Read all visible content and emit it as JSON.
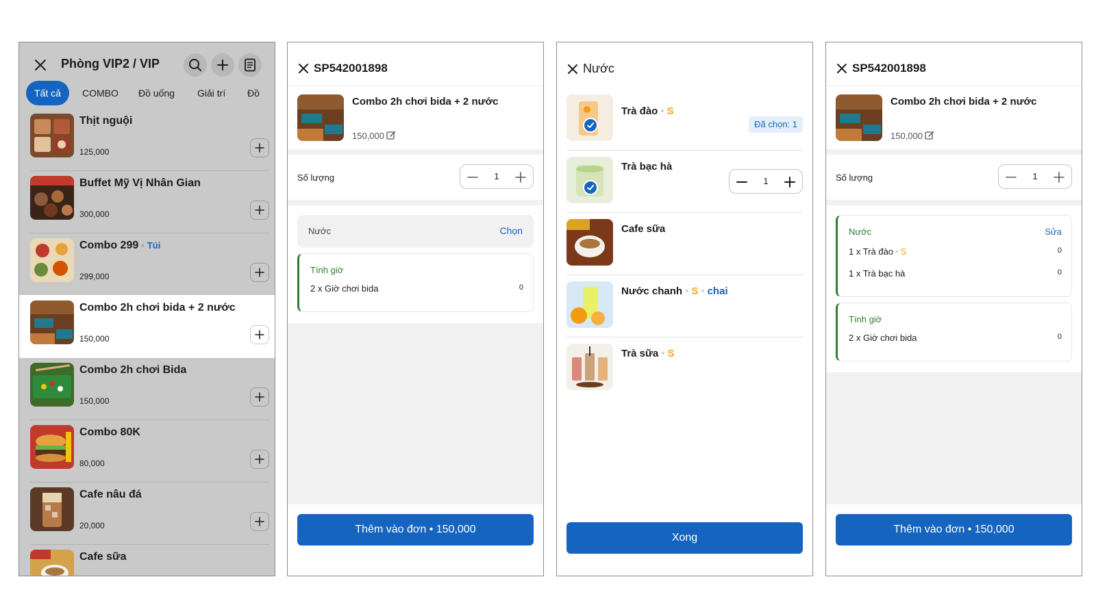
{
  "screen1": {
    "title": "Phòng VIP2 / VIP",
    "tabs": [
      "Tất cả",
      "COMBO",
      "Đồ uống",
      "Giải trí",
      "Đồ"
    ],
    "items": [
      {
        "name": "Thịt nguội",
        "price": "125,000"
      },
      {
        "name": "Buffet Mỹ Vị Nhân Gian",
        "price": "300,000"
      },
      {
        "name": "Combo 299",
        "tag": "Túi",
        "price": "299,000"
      },
      {
        "name": "Combo 2h chơi bida + 2 nước",
        "price": "150,000"
      },
      {
        "name": "Combo 2h chơi Bida",
        "price": "150,000"
      },
      {
        "name": "Combo 80K",
        "price": "80,000"
      },
      {
        "name": "Cafe nâu đá",
        "price": "20,000"
      },
      {
        "name": "Cafe sữa",
        "price": ""
      }
    ]
  },
  "screen2": {
    "title": "SP542001898",
    "product_name": "Combo 2h chơi bida + 2 nước",
    "product_price": "150,000",
    "qty_label": "Số lượng",
    "qty": "1",
    "group_drink": {
      "title": "Nước",
      "action": "Chọn"
    },
    "group_time": {
      "title": "Tính giờ",
      "rows": [
        {
          "label": "2 x Giờ chơi bida",
          "value": "0"
        }
      ]
    },
    "submit": "Thêm vào đơn • 150,000"
  },
  "screen3": {
    "title": "Nước",
    "items": [
      {
        "name": "Trà đào",
        "size": "S",
        "selected_badge": "Đã chọn: 1"
      },
      {
        "name": "Trà bạc hà",
        "qty": "1"
      },
      {
        "name": "Cafe sữa"
      },
      {
        "name": "Nước chanh",
        "size": "S",
        "unit": "chai"
      },
      {
        "name": "Trà sữa",
        "size": "S"
      }
    ],
    "done": "Xong"
  },
  "screen4": {
    "title": "SP542001898",
    "product_name": "Combo 2h chơi bida + 2 nước",
    "product_price": "150,000",
    "qty_label": "Số lượng",
    "qty": "1",
    "group_drink": {
      "title": "Nước",
      "action": "Sửa",
      "rows": [
        {
          "label": "1 x Trà đào",
          "size": "S",
          "value": "0"
        },
        {
          "label": "1 x Trà bạc hà",
          "value": "0"
        }
      ]
    },
    "group_time": {
      "title": "Tính giờ",
      "rows": [
        {
          "label": "2 x Giờ chơi bida",
          "value": "0"
        }
      ]
    },
    "submit": "Thêm vào đơn • 150,000"
  },
  "colors": {
    "primary": "#1565c0",
    "success": "#2e7d32",
    "size_accent": "#f5a623",
    "overlay": "#c9c9c9"
  },
  "icons": [
    "close-icon",
    "search-icon",
    "plus-icon",
    "receipt-icon",
    "edit-icon",
    "minus-icon",
    "check-icon"
  ]
}
